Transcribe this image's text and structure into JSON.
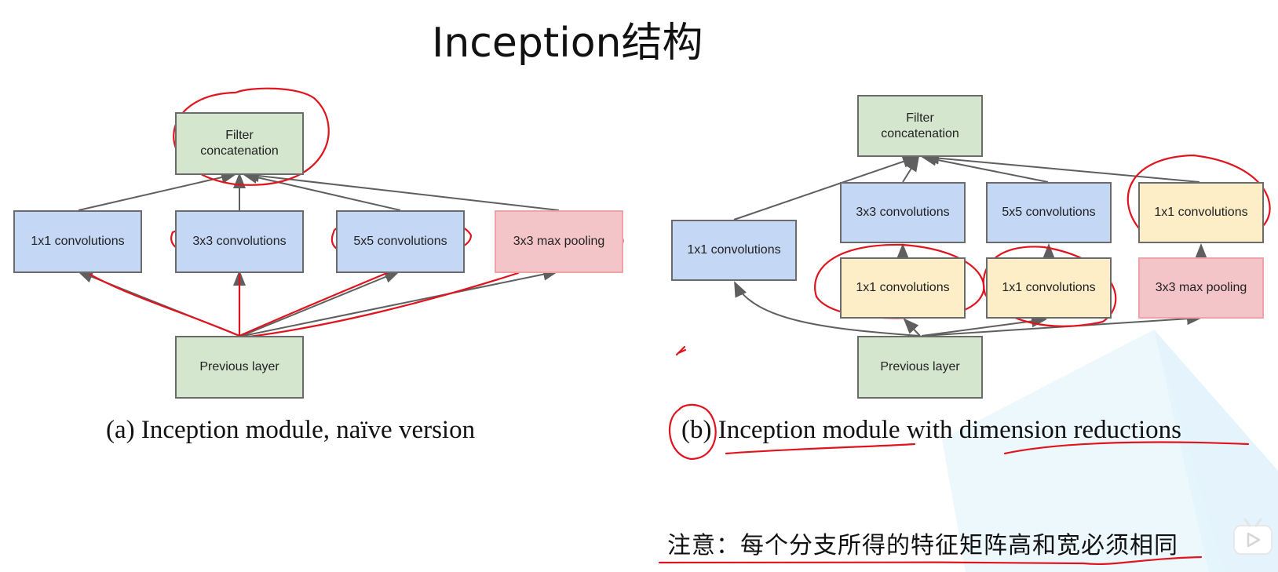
{
  "slide": {
    "title": "Inception结构",
    "note": "注意：每个分支所得的特征矩阵高和宽必须相同"
  },
  "diagram_a": {
    "caption": "(a) Inception module, naïve version",
    "nodes": {
      "filter_concat": "Filter concatenation",
      "conv1x1": "1x1 convolutions",
      "conv3x3": "3x3 convolutions",
      "conv5x5": "5x5 convolutions",
      "maxpool": "3x3 max pooling",
      "previous": "Previous layer"
    }
  },
  "diagram_b": {
    "caption": "(b) Inception module with dimension reductions",
    "nodes": {
      "filter_concat": "Filter concatenation",
      "conv1x1_branch": "1x1 convolutions",
      "conv3x3": "3x3 convolutions",
      "conv5x5": "5x5 convolutions",
      "pool_proj": "1x1 convolutions",
      "reduce3x3": "1x1 convolutions",
      "reduce5x5": "1x1 convolutions",
      "maxpool": "3x3 max pooling",
      "previous": "Previous layer"
    }
  },
  "colors": {
    "green": "#d5e6cf",
    "blue": "#c4d7f5",
    "yellow": "#fdeec7",
    "pink": "#f3c5c8",
    "annotation_red": "#e0141e",
    "edge": "#5f5f5f"
  },
  "overlay": {
    "player_logo": "tv-play-icon"
  }
}
